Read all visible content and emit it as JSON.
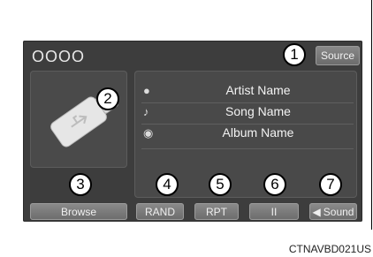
{
  "header": {
    "dots": "OOOO",
    "source_label": "Source"
  },
  "media": {
    "artist": "Artist Name",
    "song": "Song Name",
    "album": "Album Name"
  },
  "buttons": {
    "browse": "Browse",
    "rand": "RAND",
    "rpt": "RPT",
    "pause": "II",
    "sound": "Sound"
  },
  "callouts": {
    "c1": "1",
    "c2": "2",
    "c3": "3",
    "c4": "4",
    "c5": "5",
    "c6": "6",
    "c7": "7"
  },
  "footer": {
    "code": "CTNAVBD021US"
  },
  "icons": {
    "usb": "usb-drive-icon",
    "artist": "person-icon",
    "song": "music-note-icon",
    "album": "disc-icon",
    "sound": "speaker-icon"
  }
}
